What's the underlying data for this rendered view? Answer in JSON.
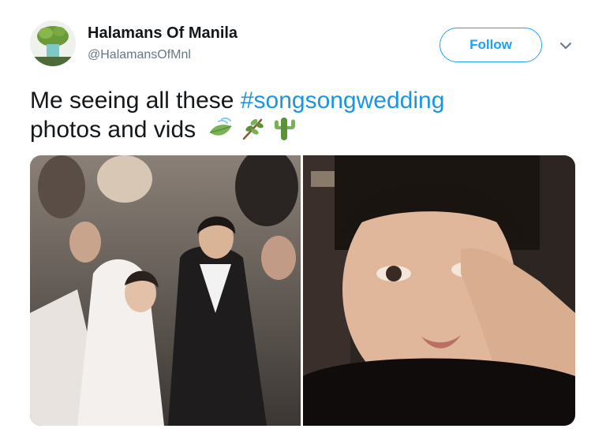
{
  "author": {
    "name": "Halamans Of Manila",
    "handle": "@HalamansOfMnl"
  },
  "follow_button": {
    "label": "Follow"
  },
  "tweet": {
    "text_before_hashtag": "Me seeing all these ",
    "hashtag": "#songsongwedding",
    "text_after_hashtag": "photos and vids"
  },
  "emojis": [
    "leaf-fluttering-in-wind-icon",
    "herb-icon",
    "cactus-icon"
  ],
  "colors": {
    "accent": "#1da1f2",
    "hashtag": "#1b95e0",
    "text": "#14171a",
    "secondary_text": "#657786"
  }
}
